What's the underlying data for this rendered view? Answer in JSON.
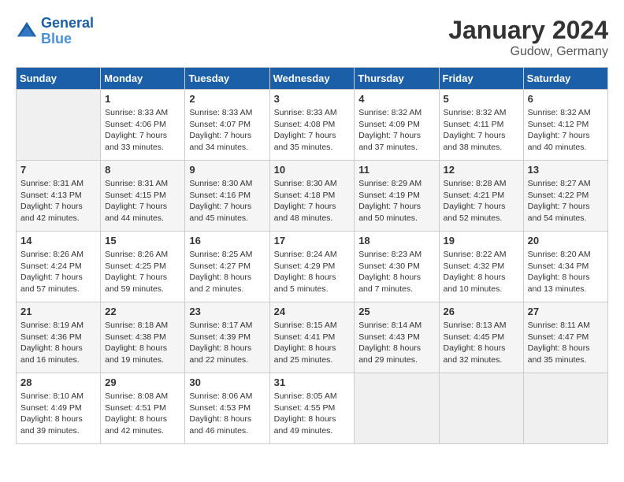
{
  "header": {
    "logo_line1": "General",
    "logo_line2": "Blue",
    "month": "January 2024",
    "location": "Gudow, Germany"
  },
  "days_of_week": [
    "Sunday",
    "Monday",
    "Tuesday",
    "Wednesday",
    "Thursday",
    "Friday",
    "Saturday"
  ],
  "weeks": [
    [
      {
        "num": "",
        "empty": true
      },
      {
        "num": "1",
        "sunrise": "Sunrise: 8:33 AM",
        "sunset": "Sunset: 4:06 PM",
        "daylight": "Daylight: 7 hours and 33 minutes."
      },
      {
        "num": "2",
        "sunrise": "Sunrise: 8:33 AM",
        "sunset": "Sunset: 4:07 PM",
        "daylight": "Daylight: 7 hours and 34 minutes."
      },
      {
        "num": "3",
        "sunrise": "Sunrise: 8:33 AM",
        "sunset": "Sunset: 4:08 PM",
        "daylight": "Daylight: 7 hours and 35 minutes."
      },
      {
        "num": "4",
        "sunrise": "Sunrise: 8:32 AM",
        "sunset": "Sunset: 4:09 PM",
        "daylight": "Daylight: 7 hours and 37 minutes."
      },
      {
        "num": "5",
        "sunrise": "Sunrise: 8:32 AM",
        "sunset": "Sunset: 4:11 PM",
        "daylight": "Daylight: 7 hours and 38 minutes."
      },
      {
        "num": "6",
        "sunrise": "Sunrise: 8:32 AM",
        "sunset": "Sunset: 4:12 PM",
        "daylight": "Daylight: 7 hours and 40 minutes."
      }
    ],
    [
      {
        "num": "7",
        "sunrise": "Sunrise: 8:31 AM",
        "sunset": "Sunset: 4:13 PM",
        "daylight": "Daylight: 7 hours and 42 minutes."
      },
      {
        "num": "8",
        "sunrise": "Sunrise: 8:31 AM",
        "sunset": "Sunset: 4:15 PM",
        "daylight": "Daylight: 7 hours and 44 minutes."
      },
      {
        "num": "9",
        "sunrise": "Sunrise: 8:30 AM",
        "sunset": "Sunset: 4:16 PM",
        "daylight": "Daylight: 7 hours and 45 minutes."
      },
      {
        "num": "10",
        "sunrise": "Sunrise: 8:30 AM",
        "sunset": "Sunset: 4:18 PM",
        "daylight": "Daylight: 7 hours and 48 minutes."
      },
      {
        "num": "11",
        "sunrise": "Sunrise: 8:29 AM",
        "sunset": "Sunset: 4:19 PM",
        "daylight": "Daylight: 7 hours and 50 minutes."
      },
      {
        "num": "12",
        "sunrise": "Sunrise: 8:28 AM",
        "sunset": "Sunset: 4:21 PM",
        "daylight": "Daylight: 7 hours and 52 minutes."
      },
      {
        "num": "13",
        "sunrise": "Sunrise: 8:27 AM",
        "sunset": "Sunset: 4:22 PM",
        "daylight": "Daylight: 7 hours and 54 minutes."
      }
    ],
    [
      {
        "num": "14",
        "sunrise": "Sunrise: 8:26 AM",
        "sunset": "Sunset: 4:24 PM",
        "daylight": "Daylight: 7 hours and 57 minutes."
      },
      {
        "num": "15",
        "sunrise": "Sunrise: 8:26 AM",
        "sunset": "Sunset: 4:25 PM",
        "daylight": "Daylight: 7 hours and 59 minutes."
      },
      {
        "num": "16",
        "sunrise": "Sunrise: 8:25 AM",
        "sunset": "Sunset: 4:27 PM",
        "daylight": "Daylight: 8 hours and 2 minutes."
      },
      {
        "num": "17",
        "sunrise": "Sunrise: 8:24 AM",
        "sunset": "Sunset: 4:29 PM",
        "daylight": "Daylight: 8 hours and 5 minutes."
      },
      {
        "num": "18",
        "sunrise": "Sunrise: 8:23 AM",
        "sunset": "Sunset: 4:30 PM",
        "daylight": "Daylight: 8 hours and 7 minutes."
      },
      {
        "num": "19",
        "sunrise": "Sunrise: 8:22 AM",
        "sunset": "Sunset: 4:32 PM",
        "daylight": "Daylight: 8 hours and 10 minutes."
      },
      {
        "num": "20",
        "sunrise": "Sunrise: 8:20 AM",
        "sunset": "Sunset: 4:34 PM",
        "daylight": "Daylight: 8 hours and 13 minutes."
      }
    ],
    [
      {
        "num": "21",
        "sunrise": "Sunrise: 8:19 AM",
        "sunset": "Sunset: 4:36 PM",
        "daylight": "Daylight: 8 hours and 16 minutes."
      },
      {
        "num": "22",
        "sunrise": "Sunrise: 8:18 AM",
        "sunset": "Sunset: 4:38 PM",
        "daylight": "Daylight: 8 hours and 19 minutes."
      },
      {
        "num": "23",
        "sunrise": "Sunrise: 8:17 AM",
        "sunset": "Sunset: 4:39 PM",
        "daylight": "Daylight: 8 hours and 22 minutes."
      },
      {
        "num": "24",
        "sunrise": "Sunrise: 8:15 AM",
        "sunset": "Sunset: 4:41 PM",
        "daylight": "Daylight: 8 hours and 25 minutes."
      },
      {
        "num": "25",
        "sunrise": "Sunrise: 8:14 AM",
        "sunset": "Sunset: 4:43 PM",
        "daylight": "Daylight: 8 hours and 29 minutes."
      },
      {
        "num": "26",
        "sunrise": "Sunrise: 8:13 AM",
        "sunset": "Sunset: 4:45 PM",
        "daylight": "Daylight: 8 hours and 32 minutes."
      },
      {
        "num": "27",
        "sunrise": "Sunrise: 8:11 AM",
        "sunset": "Sunset: 4:47 PM",
        "daylight": "Daylight: 8 hours and 35 minutes."
      }
    ],
    [
      {
        "num": "28",
        "sunrise": "Sunrise: 8:10 AM",
        "sunset": "Sunset: 4:49 PM",
        "daylight": "Daylight: 8 hours and 39 minutes."
      },
      {
        "num": "29",
        "sunrise": "Sunrise: 8:08 AM",
        "sunset": "Sunset: 4:51 PM",
        "daylight": "Daylight: 8 hours and 42 minutes."
      },
      {
        "num": "30",
        "sunrise": "Sunrise: 8:06 AM",
        "sunset": "Sunset: 4:53 PM",
        "daylight": "Daylight: 8 hours and 46 minutes."
      },
      {
        "num": "31",
        "sunrise": "Sunrise: 8:05 AM",
        "sunset": "Sunset: 4:55 PM",
        "daylight": "Daylight: 8 hours and 49 minutes."
      },
      {
        "num": "",
        "empty": true
      },
      {
        "num": "",
        "empty": true
      },
      {
        "num": "",
        "empty": true
      }
    ]
  ]
}
